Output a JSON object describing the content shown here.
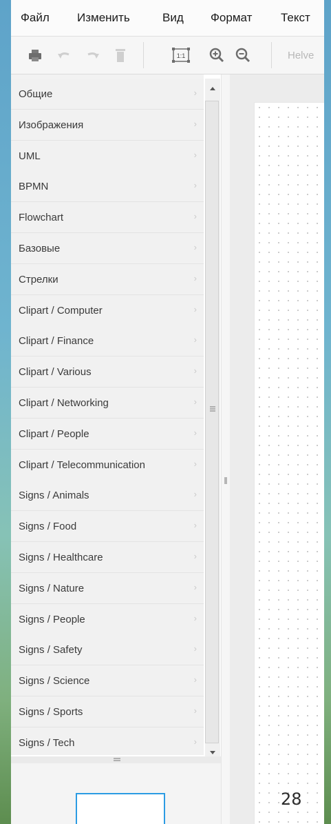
{
  "menu": {
    "items": [
      "Файл",
      "Изменить",
      "Вид",
      "Формат",
      "Текст"
    ]
  },
  "toolbar": {
    "buttons": [
      "print-icon",
      "undo-icon",
      "redo-icon",
      "delete-icon",
      "actual-size-icon",
      "zoom-in-icon",
      "zoom-out-icon"
    ],
    "actual_size_label": "1:1",
    "font_name": "Helve"
  },
  "sidebar": {
    "categories": [
      "Общие",
      "Изображения",
      "UML",
      "BPMN",
      "Flowchart",
      "Базовые",
      "Стрелки",
      "Clipart / Computer",
      "Clipart / Finance",
      "Clipart / Various",
      "Clipart / Networking",
      "Clipart / People",
      "Clipart / Telecommunication",
      "Signs / Animals",
      "Signs / Food",
      "Signs / Healthcare",
      "Signs / Nature",
      "Signs / People",
      "Signs / Safety",
      "Signs / Science",
      "Signs / Sports",
      "Signs / Tech"
    ],
    "arrow": "›"
  },
  "slide": {
    "page_number": "28"
  },
  "colors": {
    "accent": "#2b9be3",
    "menubar_bg": "#fbfbfb",
    "sidebar_bg": "#f2f2f2"
  }
}
